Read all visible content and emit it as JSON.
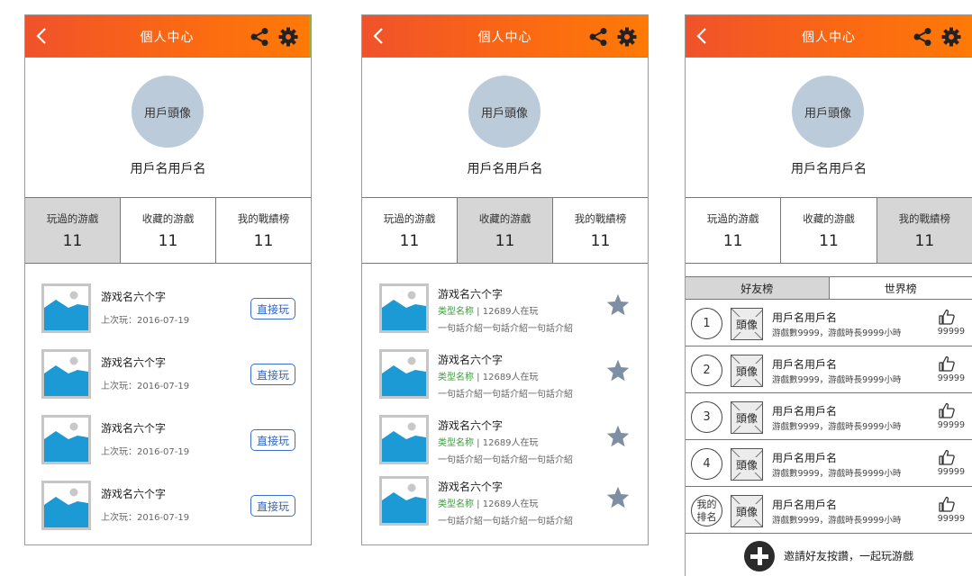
{
  "common": {
    "header_title": "個人中心",
    "avatar_text": "用戶頭像",
    "username": "用戶名用戶名",
    "stats": [
      {
        "label": "玩過的游戲",
        "count": "11"
      },
      {
        "label": "收藏的游戲",
        "count": "11"
      },
      {
        "label": "我的戰績榜",
        "count": "11"
      }
    ]
  },
  "screen1": {
    "active_stat": 0,
    "games": [
      {
        "name": "游戏名六个字",
        "last_played": "上次玩：2016-07-19",
        "button": "直接玩"
      },
      {
        "name": "游戏名六个字",
        "last_played": "上次玩：2016-07-19",
        "button": "直接玩"
      },
      {
        "name": "游戏名六个字",
        "last_played": "上次玩：2016-07-19",
        "button": "直接玩"
      },
      {
        "name": "游戏名六个字",
        "last_played": "上次玩：2016-07-19",
        "button": "直接玩"
      }
    ]
  },
  "screen2": {
    "active_stat": 1,
    "games": [
      {
        "name": "游戏名六个字",
        "type": "类型名称",
        "players": "12689人在玩",
        "desc": "一句話介紹一句話介紹一句話介紹"
      },
      {
        "name": "游戏名六个字",
        "type": "类型名称",
        "players": "12689人在玩",
        "desc": "一句話介紹一句話介紹一句話介紹"
      },
      {
        "name": "游戏名六个字",
        "type": "类型名称",
        "players": "12689人在玩",
        "desc": "一句話介紹一句話介紹一句話介紹"
      },
      {
        "name": "游戏名六个字",
        "type": "类型名称",
        "players": "12689人在玩",
        "desc": "一句話介紹一句話介紹一句話介紹"
      }
    ]
  },
  "screen3": {
    "active_stat": 2,
    "tabs": [
      {
        "label": "好友榜"
      },
      {
        "label": "世界榜"
      }
    ],
    "active_tab": 0,
    "ranks": [
      {
        "rank": "1",
        "head": "頭像",
        "name": "用戶名用戶名",
        "info": "游戲數9999，游戲時長9999小時",
        "likes": "99999"
      },
      {
        "rank": "2",
        "head": "頭像",
        "name": "用戶名用戶名",
        "info": "游戲數9999，游戲時長9999小時",
        "likes": "99999"
      },
      {
        "rank": "3",
        "head": "頭像",
        "name": "用戶名用戶名",
        "info": "游戲數9999，游戲時長9999小時",
        "likes": "99999"
      },
      {
        "rank": "4",
        "head": "頭像",
        "name": "用戶名用戶名",
        "info": "游戲數9999，游戲時長9999小時",
        "likes": "99999"
      },
      {
        "rank_line1": "我的",
        "rank_line2": "排名",
        "head": "頭像",
        "name": "用戶名用戶名",
        "info": "游戲數9999，游戲時長9999小時",
        "likes": "99999"
      }
    ],
    "invite_text": "邀請好友按讚，一起玩游戲"
  },
  "icons": {
    "back": "chevron-left-icon",
    "share": "share-icon",
    "settings": "gear-icon",
    "game_thumb": "image-placeholder-icon",
    "favorite": "star-icon",
    "like": "thumbs-up-icon",
    "invite": "plus-circle-icon"
  },
  "colors": {
    "header_start": "#f0522a",
    "header_end": "#fe7a06",
    "avatar_bg": "#bccbd9",
    "active_tab_bg": "#d6d6d6",
    "play_button": "#2d64c8",
    "type_text": "#3e9a3e",
    "star": "#7f8fa3",
    "thumb_blue": "#1b9ad6"
  }
}
